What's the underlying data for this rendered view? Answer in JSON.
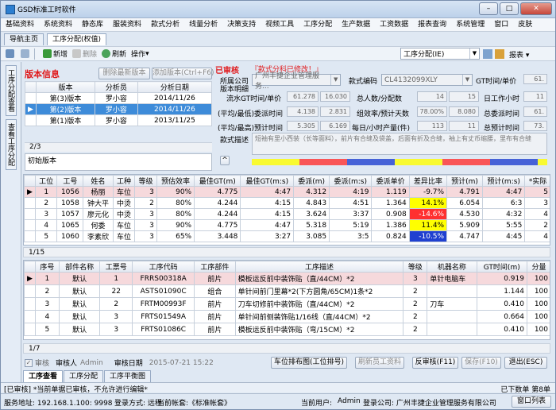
{
  "app": {
    "title": "GSD标准工时软件",
    "win_min": "–",
    "win_max": "□",
    "win_close": "✕"
  },
  "menu": [
    "基础资料",
    "系统资料",
    "静态库",
    "服装资料",
    "款式分析",
    "线量分析",
    "决策支持",
    "视频工具",
    "工序分配",
    "生产数据",
    "工资数据",
    "报表查询",
    "系统管理",
    "窗口",
    "皮肤"
  ],
  "tabs": [
    "导航主页",
    "工序分配(权值)"
  ],
  "toolbar": {
    "new": "新增",
    "delete": "删除",
    "refresh": "刷新",
    "ops": "操作",
    "module": "工序分配(IE)",
    "reports": "报表"
  },
  "sidebar": [
    "工序分配查看",
    "查看工序分配"
  ],
  "version": {
    "title": "版本信息",
    "btn_delete": "删除最新版本",
    "btn_add": "添加版本(Ctrl+F6)",
    "headers": [
      "版本",
      "分析员",
      "分析日期"
    ],
    "rows": [
      [
        "第(3)版本",
        "罗小容",
        "2014/11/26"
      ],
      [
        "第(2)版本",
        "罗小容",
        "2014/11/26"
      ],
      [
        "第(1)版本",
        "罗小容",
        "2013/11/25"
      ]
    ],
    "pager": "2/3",
    "note": "初始版本"
  },
  "info": {
    "status": "已审核",
    "warning": "『款式分科已修改！』",
    "company_label": "所属公司",
    "company_value": "广州丰捷企业管理服务...",
    "style_label": "款式编码",
    "style_value": "CL4132099XLY",
    "gt_label": "GT时间/单价",
    "gt_value": "61.",
    "version_label": "版本明细",
    "r1": {
      "l1": "流水GT时间/单价",
      "v1a": "61.278",
      "v1b": "16.030",
      "l2": "总人数/分配数",
      "v2a": "14",
      "v2b": "15",
      "l3": "日工作小时",
      "v3": "11"
    },
    "r2": {
      "l1": "(平均/最低)委派时间",
      "v1a": "4.138",
      "v1b": "2.831",
      "l2": "组效率/预计天数",
      "v2a": "78.00%",
      "v2b": "8.080",
      "l3": "总委派时间",
      "v3": "61."
    },
    "r3": {
      "l1": "(平均/最高)预计时间",
      "v1a": "5.305",
      "v1b": "6.169",
      "l2": "每日/小时产量(件)",
      "v2a": "113",
      "v2b": "11",
      "l3": "总预计时间",
      "v3": "73."
    },
    "desc_label": "款式描述",
    "desc_value": "短袖有里小西装（长等面料），前片有合缝及袋盖，后面有折及合缝，袖上有丈币缩腰，里布有合缝"
  },
  "op_grid": {
    "headers": [
      "工位",
      "工号",
      "姓名",
      "工种",
      "等级",
      "预估效率",
      "最佳GT(m)",
      "最佳GT(m:s)",
      "委派(m)",
      "委派(m:s)",
      "委派单价",
      "差异比率",
      "预计(m)",
      "预计(m:s)",
      "*实际"
    ],
    "rows": [
      [
        "1",
        "1056",
        "杨丽",
        "车位",
        "3",
        "90%",
        "4.775",
        "4:47",
        "4.312",
        "4:19",
        "1.119",
        "-9.7%",
        "4.791",
        "4:47",
        "5"
      ],
      [
        "2",
        "1058",
        "钟大平",
        "中烫",
        "2",
        "80%",
        "4.244",
        "4:15",
        "4.843",
        "4:51",
        "1.364",
        "14.1%",
        "6.054",
        "6:3",
        "3"
      ],
      [
        "3",
        "1057",
        "廖元化",
        "中烫",
        "3",
        "80%",
        "4.244",
        "4:15",
        "3.624",
        "3:37",
        "0.908",
        "-14.6%",
        "4.530",
        "4:32",
        "4"
      ],
      [
        "4",
        "1065",
        "何委",
        "车位",
        "3",
        "90%",
        "4.775",
        "4:47",
        "5.318",
        "5:19",
        "1.386",
        "11.4%",
        "5.909",
        "5:55",
        "2"
      ],
      [
        "5",
        "1060",
        "李素欣",
        "车位",
        "3",
        "65%",
        "3.448",
        "3:27",
        "3.085",
        "3:5",
        "0.824",
        "-10.5%",
        "4.747",
        "4:45",
        "4"
      ]
    ],
    "pager": "1/15"
  },
  "proc_grid": {
    "headers": [
      "序号",
      "部件名称",
      "工票号",
      "工序代码",
      "工序部件",
      "工序描述",
      "等级",
      "机器名称",
      "GT时间(m)",
      "分量"
    ],
    "rows": [
      [
        "1",
        "默认",
        "1",
        "FRRS00318A",
        "前片",
        "模板运反前中装饰贴（直/44CM）*2",
        "3",
        "单针电脑车",
        "0.919",
        "100"
      ],
      [
        "2",
        "默认",
        "22",
        "ASTS01090C",
        "组合",
        "单针间前门里幕*2(下方圆角/65CM)1条*2",
        "2",
        "",
        "1.144",
        "100"
      ],
      [
        "3",
        "默认",
        "2",
        "FRTM00993F",
        "前片",
        "刀车切修前中装饰贴（直/44CM）*2",
        "2",
        "刀车",
        "0.410",
        "100"
      ],
      [
        "4",
        "默认",
        "3",
        "FRTS01549A",
        "前片",
        "单针间前侧装饰贴1/16线（直/44CM）*2",
        "2",
        "",
        "0.664",
        "100"
      ],
      [
        "5",
        "默认",
        "3",
        "FRTS01086C",
        "前片",
        "模板运反前中装饰贴（弯/15CM）*2",
        "2",
        "",
        "0.410",
        "100"
      ]
    ],
    "pager": "1/7"
  },
  "bottom": {
    "audit": "审核",
    "auditor_label": "审核人",
    "auditor": "Admin",
    "audit_date_label": "审核日期",
    "audit_date": "2015-07-21 15:22",
    "btn_station": "车位排布图(工位排号)",
    "btn_reset": "刷新员工资料",
    "btn_unaudit": "反审核(F11)",
    "btn_save": "保存(F10)",
    "btn_exit": "退出(ESC)"
  },
  "subtabs": [
    "工序查看",
    "工序分配",
    "工序平衡图"
  ],
  "msg": {
    "left": "[已审核] *当前单据已审核，不允许进行编辑*",
    "right": "已下数单  第8单"
  },
  "status": {
    "server": "服务地址: 192.168.1.100: 9998",
    "login": "登录方式: 远程",
    "account": "当前帐套:《标准帐套》",
    "user_label": "当前用户:",
    "user": "Admin",
    "company": "登录公司: 广州丰捷企业管理服务有限公司",
    "windows": "窗口列表"
  },
  "colors": {
    "accent": "#3d8bd9",
    "status_red": "#e0191b",
    "warn_yellow": "#ffff00",
    "warn_red": "#ff3030"
  }
}
